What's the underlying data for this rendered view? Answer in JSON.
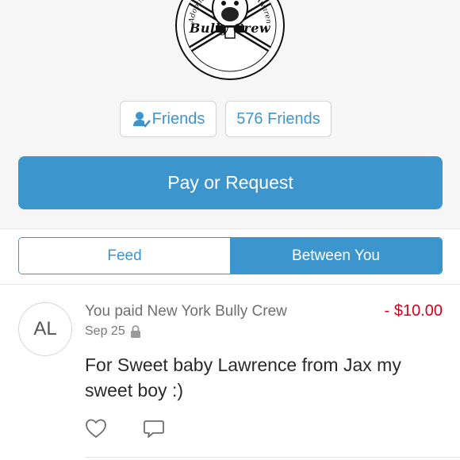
{
  "logo": {
    "text": "Bully Crew",
    "arc_text": "Adoption · Education · Awareness · Rescue",
    "icon": "bully-crew-logo"
  },
  "profile": {
    "friends_label": "Friends",
    "friends_icon": "friends-check-icon",
    "friends_count_label": "576 Friends"
  },
  "actions": {
    "pay_request_label": "Pay or Request"
  },
  "tabs": [
    {
      "label": "Feed",
      "selected": false
    },
    {
      "label": "Between You",
      "selected": true
    }
  ],
  "story": {
    "avatar_initials": "AL",
    "title": "You paid New York Bully Crew",
    "amount": "- $10.00",
    "date": "Sep 25",
    "privacy_icon": "lock-icon",
    "note": "For Sweet baby Lawrence  from Jax my sweet boy :)"
  },
  "colors": {
    "accent": "#3d95ce",
    "negative_amount": "#d0021b",
    "background_top": "#f6f6f6"
  }
}
